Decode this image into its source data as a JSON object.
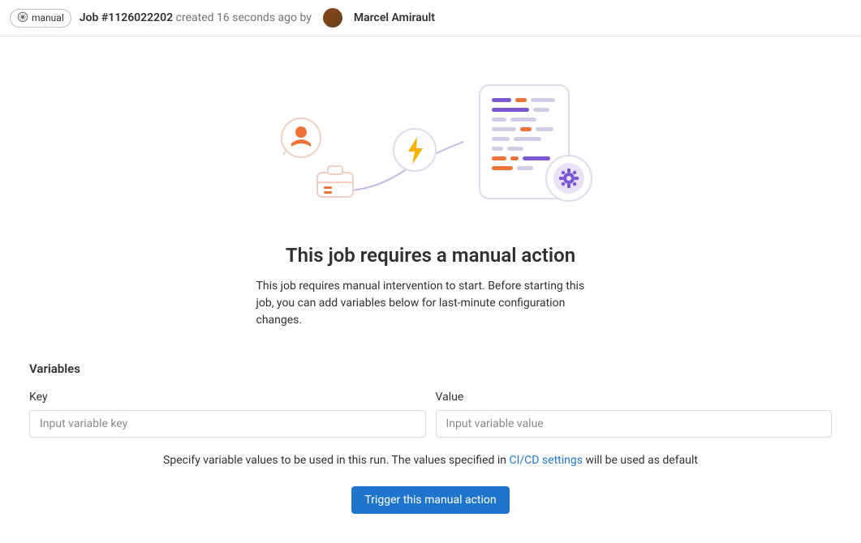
{
  "header": {
    "status_label": "manual",
    "job_title": "Job #1126022202",
    "created_text": "created 16 seconds ago by",
    "author_name": "Marcel Amirault"
  },
  "content": {
    "heading": "This job requires a manual action",
    "description": "This job requires manual intervention to start. Before starting this job, you can add variables below for last-minute configuration changes."
  },
  "variables": {
    "section_title": "Variables",
    "key_label": "Key",
    "value_label": "Value",
    "key_placeholder": "Input variable key",
    "value_placeholder": "Input variable value"
  },
  "hint": {
    "prefix": "Specify variable values to be used in this run. The values specified in ",
    "link_text": "CI/CD settings",
    "suffix": " will be used as default"
  },
  "trigger": {
    "button_label": "Trigger this manual action"
  }
}
